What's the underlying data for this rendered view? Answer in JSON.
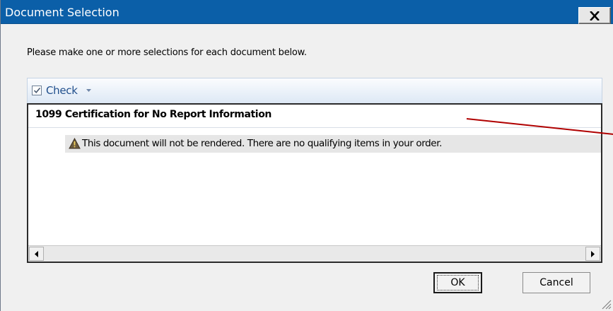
{
  "window": {
    "title": "Document Selection",
    "close_glyph": "X"
  },
  "instruction": "Please make one or more selections for each document below.",
  "toolbar": {
    "check_label": "Check",
    "check_icon": "checkbox-checked-icon",
    "dropdown_icon": "chevron-down-icon"
  },
  "document": {
    "title": "1099 Certification for No Report Information",
    "message": "This document will not be rendered. There are no qualifying items in your order.",
    "message_icon": "warning-icon"
  },
  "buttons": {
    "ok": "OK",
    "cancel": "Cancel"
  },
  "colors": {
    "titlebar": "#0b5fa8",
    "annotation_line": "#b00000"
  }
}
